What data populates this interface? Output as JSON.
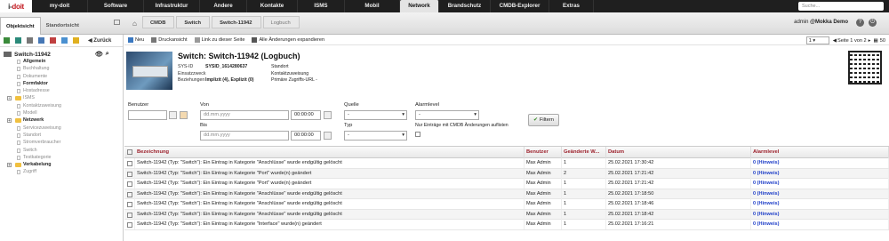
{
  "app": {
    "logo_left": "i-",
    "logo_right": "doit"
  },
  "topnav": {
    "items": [
      {
        "label": "my-doit",
        "width": 63
      },
      {
        "label": "Software",
        "width": 63
      },
      {
        "label": "Infrastruktur",
        "width": 63
      },
      {
        "label": "Andere",
        "width": 53
      },
      {
        "label": "Kontakte",
        "width": 57
      },
      {
        "label": "ISMS",
        "width": 53
      },
      {
        "label": "Mobil",
        "width": 62
      },
      {
        "label": "Network",
        "width": 44,
        "active": true
      },
      {
        "label": "Brandschutz",
        "width": 58
      },
      {
        "label": "CMDB-Explorer",
        "width": 66
      },
      {
        "label": "Extras",
        "width": 50
      }
    ],
    "search_placeholder": "Suche..."
  },
  "subbar": {
    "tabs": [
      "Objektsicht",
      "Standortsicht"
    ],
    "breadcrumbs": [
      "CMDB",
      "Switch",
      "Switch-11942",
      "Logbuch"
    ],
    "user_label": "admin",
    "tenant": "@Mokka Demo"
  },
  "sidebar": {
    "back_label": "Zurück",
    "root": "Switch-11942",
    "items": [
      {
        "label": "Allgemein",
        "bold": true
      },
      {
        "label": "Buchhaltung"
      },
      {
        "label": "Dokumente"
      },
      {
        "label": "Formfaktor",
        "bold": true
      },
      {
        "label": "Hostadresse"
      },
      {
        "label": "ISMS",
        "folder": true
      },
      {
        "label": "Kontaktzuweisung"
      },
      {
        "label": "Modell"
      },
      {
        "label": "Netzwerk",
        "folder": true,
        "bold": true
      },
      {
        "label": "Servicezuweisung"
      },
      {
        "label": "Standort"
      },
      {
        "label": "Stromverbraucher"
      },
      {
        "label": "Switch"
      },
      {
        "label": "Testkategorie"
      },
      {
        "label": "Verkabelung",
        "folder": true,
        "bold": true
      },
      {
        "label": "Zugriff"
      }
    ]
  },
  "toolbar": {
    "new": "Neu",
    "print": "Druckansicht",
    "link": "Link zu dieser Seite",
    "expand": "Alle Änderungen expandieren",
    "page_select": "1",
    "page_text": "Seite 1 von 2",
    "per_page": "50"
  },
  "object": {
    "title": "Switch: Switch-11942 (Logbuch)",
    "sysid_label": "SYS-ID",
    "sysid_value": "SYSID_1614280637",
    "purpose_label": "Einsatzzweck",
    "relations_label": "Beziehungen",
    "relations_value": "Implizit (4), Explizit (0)",
    "location_label": "Standort",
    "contact_label": "Kontaktzuweisung",
    "url_label": "Primäre Zugriffs-URL",
    "url_value": "-"
  },
  "filter": {
    "user_label": "Benutzer",
    "from_label": "Von",
    "to_label": "Bis",
    "date_placeholder": "dd.mm.yyyy",
    "time_value": "00:00:00",
    "source_label": "Quelle",
    "type_label": "Typ",
    "select_empty": "-",
    "alarm_label": "Alarmlevel",
    "cmdb_only": "Nur Einträge mit CMDB Änderungen auflisten",
    "button": "Filtern"
  },
  "table": {
    "headers": [
      "Bezeichnung",
      "Benutzer",
      "Geänderte W...",
      "Datum",
      "Alarmlevel"
    ],
    "rows": [
      [
        "Switch-11942 (Typ: \"Switch\"): Ein Eintrag in Kategorie \"Anschlüsse\" wurde endgültig gelöscht",
        "Max Admin",
        "1",
        "25.02.2021 17:30:42",
        "0 (Hinweis)"
      ],
      [
        "Switch-11942 (Typ: \"Switch\"): Ein Eintrag in Kategorie \"Port\" wurde(n) geändert",
        "Max Admin",
        "2",
        "25.02.2021 17:21:42",
        "0 (Hinweis)"
      ],
      [
        "Switch-11942 (Typ: \"Switch\"): Ein Eintrag in Kategorie \"Port\" wurde(n) geändert",
        "Max Admin",
        "1",
        "25.02.2021 17:21:42",
        "0 (Hinweis)"
      ],
      [
        "Switch-11942 (Typ: \"Switch\"): Ein Eintrag in Kategorie \"Anschlüsse\" wurde endgültig gelöscht",
        "Max Admin",
        "1",
        "25.02.2021 17:18:50",
        "0 (Hinweis)"
      ],
      [
        "Switch-11942 (Typ: \"Switch\"): Ein Eintrag in Kategorie \"Anschlüsse\" wurde endgültig gelöscht",
        "Max Admin",
        "1",
        "25.02.2021 17:18:46",
        "0 (Hinweis)"
      ],
      [
        "Switch-11942 (Typ: \"Switch\"): Ein Eintrag in Kategorie \"Anschlüsse\" wurde endgültig gelöscht",
        "Max Admin",
        "1",
        "25.02.2021 17:18:42",
        "0 (Hinweis)"
      ],
      [
        "Switch-11942 (Typ: \"Switch\"): Ein Eintrag in Kategorie \"Interface\" wurde(n) geändert",
        "Max Admin",
        "1",
        "25.02.2021 17:16:21",
        "0 (Hinweis)"
      ]
    ]
  }
}
